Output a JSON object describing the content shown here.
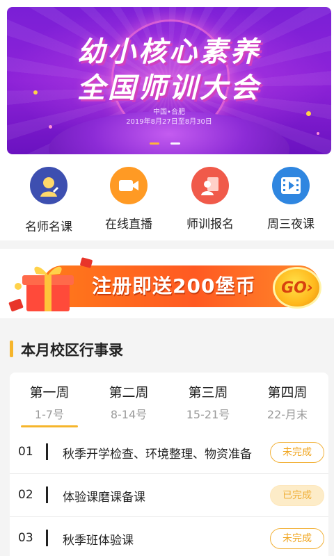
{
  "banner": {
    "title_line1": "幼小核心素养",
    "title_line2": "全国师训大会",
    "location": "中国•合肥",
    "dates": "2019年8月27日至8月30日",
    "dots": 2,
    "active_dot": 0
  },
  "nav": {
    "items": [
      {
        "label": "名师名课",
        "icon": "teacher-avatar-icon",
        "color": "#3d4fb0"
      },
      {
        "label": "在线直播",
        "icon": "video-camera-icon",
        "color": "#ff9a24"
      },
      {
        "label": "师训报名",
        "icon": "registration-icon",
        "color": "#f05a4a"
      },
      {
        "label": "周三夜课",
        "icon": "film-play-icon",
        "color": "#2f86e0"
      }
    ]
  },
  "promo": {
    "text": "注册即送200堡币",
    "go_label": "GO"
  },
  "schedule": {
    "section_title": "本月校区行事录",
    "tabs": [
      {
        "name": "第一周",
        "range": "1-7号"
      },
      {
        "name": "第二周",
        "range": "8-14号"
      },
      {
        "name": "第三周",
        "range": "15-21号"
      },
      {
        "name": "第四周",
        "range": "22-月末"
      }
    ],
    "active_tab": 0,
    "tasks": [
      {
        "num": "01",
        "name": "秋季开学检查、环境整理、物资准备",
        "status": "未完成"
      },
      {
        "num": "02",
        "name": "体验课磨课备课",
        "status": "已完成"
      },
      {
        "num": "03",
        "name": "秋季班体验课",
        "status": "未完成"
      }
    ]
  },
  "colors": {
    "accent": "#f6b52b",
    "banner_purple": "#8e23d8",
    "promo_orange": "#ff5a22"
  }
}
